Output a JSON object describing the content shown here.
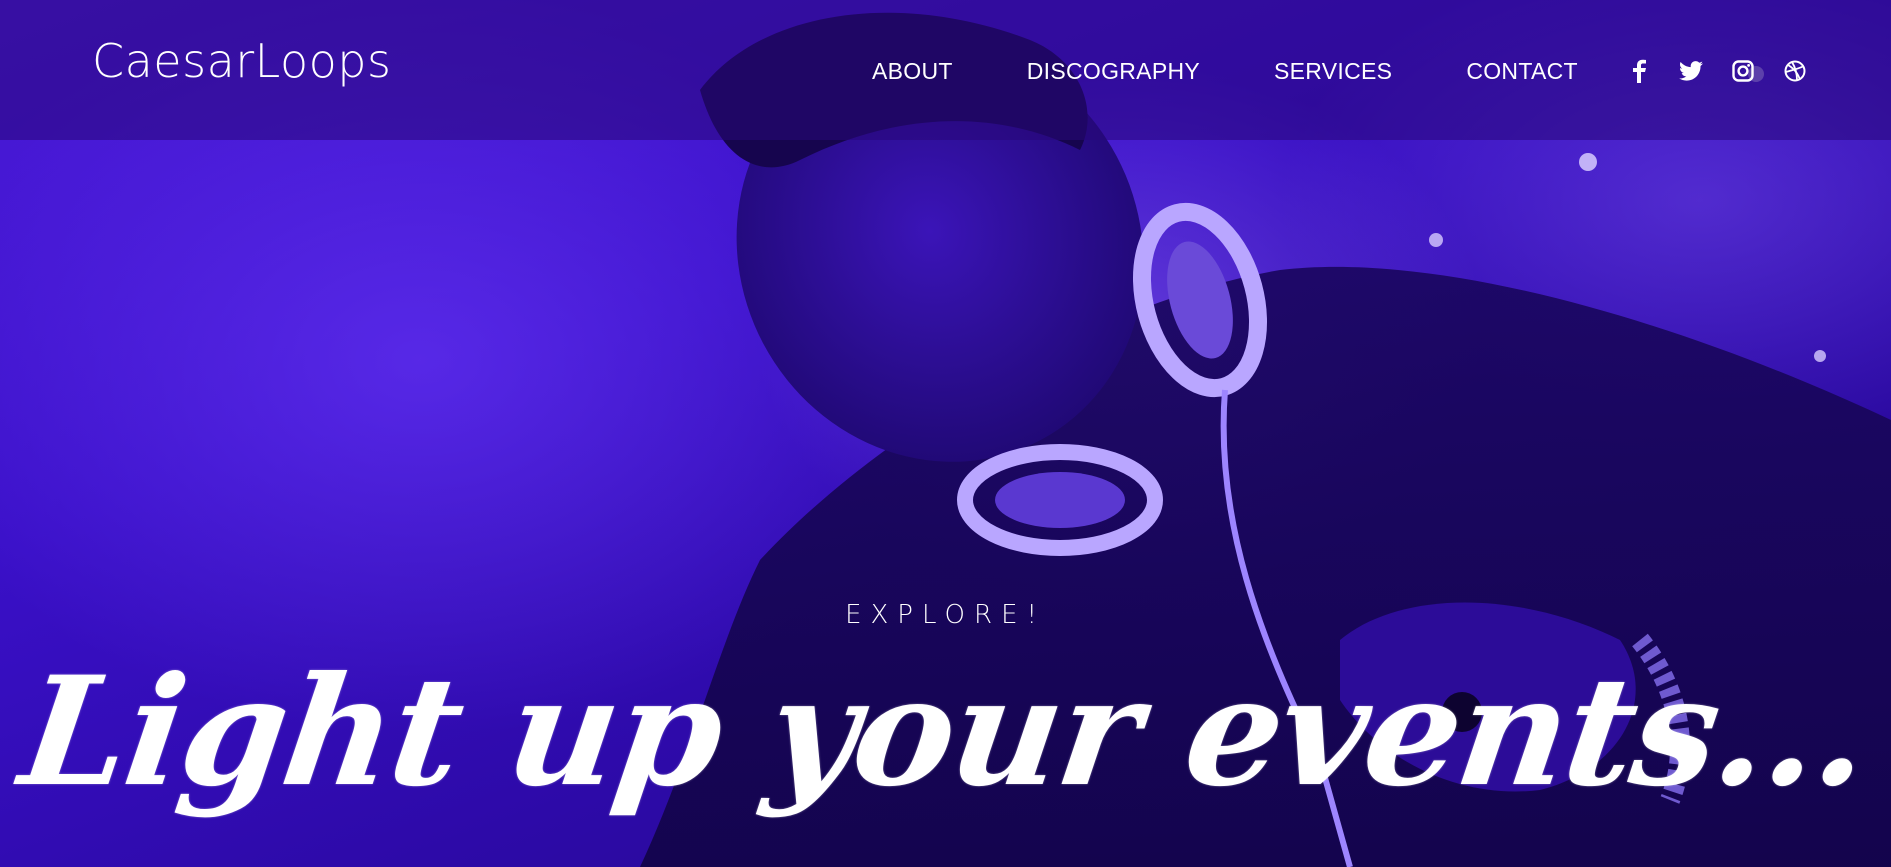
{
  "brand": {
    "logo": "CaesarLoops"
  },
  "nav": {
    "links": [
      "ABOUT",
      "DISCOGRAPHY",
      "SERVICES",
      "CONTACT"
    ]
  },
  "socials": [
    {
      "name": "facebook-icon"
    },
    {
      "name": "twitter-icon"
    },
    {
      "name": "instagram-icon"
    },
    {
      "name": "dribbble-icon"
    }
  ],
  "hero": {
    "eyebrow": "EXPLORE!",
    "headline": "Light up your events..."
  },
  "colors": {
    "accent": "#3a10c8",
    "text": "#ffffff"
  }
}
